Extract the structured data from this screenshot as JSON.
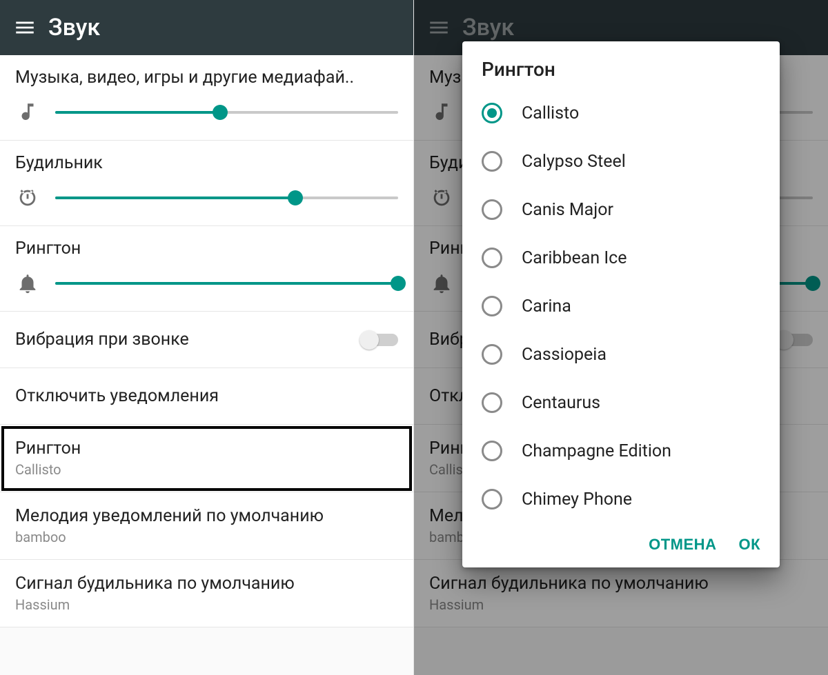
{
  "colors": {
    "accent": "#009688",
    "appbar": "#2e3b3f"
  },
  "left": {
    "header": {
      "title": "Звук"
    },
    "media": {
      "label": "Музыка, видео, игры и другие медиафай..",
      "value": 48
    },
    "alarm": {
      "label": "Будильник",
      "value": 70
    },
    "ring": {
      "label": "Рингтон",
      "value": 100
    },
    "vibrate": {
      "label": "Вибрация при звонке",
      "on": false
    },
    "dnd": {
      "label": "Отключить уведомления"
    },
    "ringtone": {
      "label": "Рингтон",
      "value": "Callisto"
    },
    "notification": {
      "label": "Мелодия уведомлений по умолчанию",
      "value": "bamboo"
    },
    "alarm_sound": {
      "label": "Сигнал будильника по умолчанию",
      "value": "Hassium"
    }
  },
  "right": {
    "header": {
      "title": "Звук"
    },
    "dialog": {
      "title": "Рингтон",
      "selected_index": 0,
      "options": [
        "Callisto",
        "Calypso Steel",
        "Canis Major",
        "Caribbean Ice",
        "Carina",
        "Cassiopeia",
        "Centaurus",
        "Champagne Edition",
        "Chimey Phone"
      ],
      "cancel": "ОТМЕНА",
      "ok": "ОК"
    }
  }
}
